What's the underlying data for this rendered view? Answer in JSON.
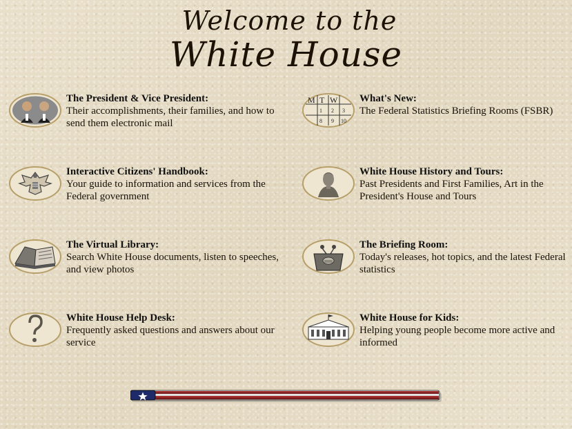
{
  "header": {
    "line1": "Welcome to the",
    "line2": "White House"
  },
  "items": [
    {
      "title": "The President & Vice President:",
      "desc": "Their accomplishments, their families, and how to send them electronic mail",
      "icon": "president-vp-portrait-icon"
    },
    {
      "title": "What's New:",
      "desc": "The Federal Statistics Briefing Rooms (FSBR)",
      "icon": "calendar-icon",
      "calendar": {
        "days": [
          "M",
          "T",
          "W"
        ],
        "dates": [
          "1",
          "2",
          "3",
          "8",
          "9",
          "10"
        ]
      }
    },
    {
      "title": "Interactive Citizens' Handbook:",
      "desc": "Your guide to information and services from the Federal government",
      "icon": "eagle-seal-icon"
    },
    {
      "title": "White House History and Tours:",
      "desc": "Past Presidents and First Families, Art in the President's House and Tours",
      "icon": "washington-bust-icon"
    },
    {
      "title": "The Virtual Library:",
      "desc": "Search White House documents, listen to speeches, and view photos",
      "icon": "open-book-icon"
    },
    {
      "title": "The Briefing Room:",
      "desc": "Today's releases, hot topics, and the latest Federal statistics",
      "icon": "podium-icon"
    },
    {
      "title": "White House Help Desk:",
      "desc": "Frequently asked questions and answers about our service",
      "icon": "question-mark-icon"
    },
    {
      "title": "White House for Kids:",
      "desc": "Helping young people become more active and informed",
      "icon": "white-house-sketch-icon"
    }
  ],
  "colors": {
    "background": "#e6dcc6",
    "oval_fill": "#efe6d2",
    "oval_border": "#b79f6a",
    "flag_blue": "#1f2a6b",
    "flag_red": "#8c1a1a"
  }
}
